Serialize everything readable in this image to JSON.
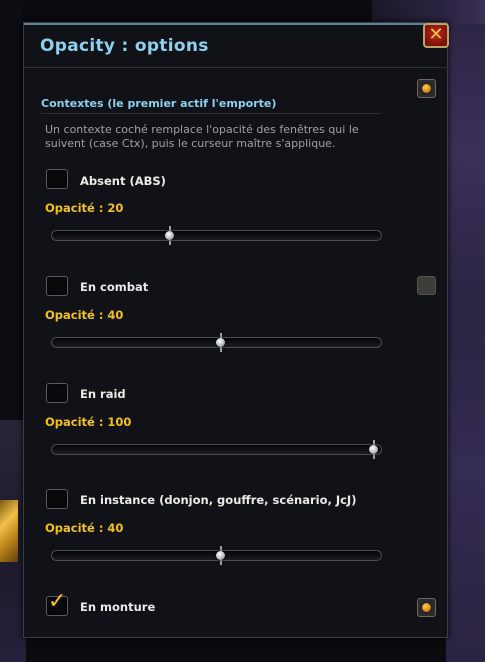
{
  "window": {
    "title": "Opacity : options",
    "close_symbol": "✕"
  },
  "section": {
    "title": "Contextes (le premier actif l'emporte)",
    "description": "Un contexte coché remplace l'opacité des fenêtres qui le suivent (case Ctx), puis le curseur maître s'applique."
  },
  "contexts": [
    {
      "label": "Absent (ABS)",
      "checked": false,
      "opacity_label": "Opacité : 20",
      "opacity": 20
    },
    {
      "label": "En combat",
      "checked": false,
      "opacity_label": "Opacité : 40",
      "opacity": 40
    },
    {
      "label": "En raid",
      "checked": false,
      "opacity_label": "Opacité : 100",
      "opacity": 100
    },
    {
      "label": "En instance (donjon, gouffre, scénario, JcJ)",
      "checked": false,
      "opacity_label": "Opacité : 40",
      "opacity": 40
    },
    {
      "label": "En monture",
      "checked": true
    }
  ],
  "slider_range": {
    "min": 0,
    "max": 100
  },
  "icons": {
    "close": "close-icon",
    "scroll_up": "scroll-up-icon",
    "scroll_thumb": "scroll-thumb-icon",
    "scroll_down": "scroll-down-icon",
    "checkmark": "checkmark-icon"
  },
  "colors": {
    "title": "#8fd0ee",
    "opacity_label": "#f2c314",
    "checkmark": "#f2c314",
    "close_button": "#c0271a"
  }
}
